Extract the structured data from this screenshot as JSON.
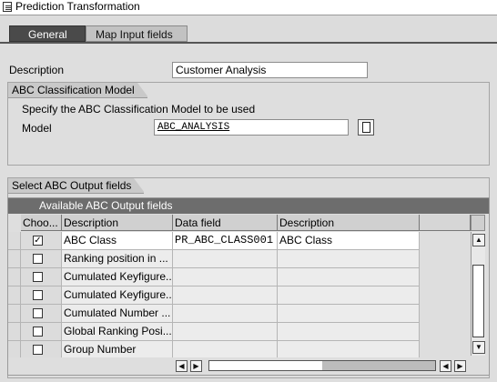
{
  "window": {
    "title": "Prediction Transformation"
  },
  "tabs": [
    {
      "label": "General",
      "active": true
    },
    {
      "label": "Map Input fields",
      "active": false
    }
  ],
  "description": {
    "label": "Description",
    "value": "Customer Analysis"
  },
  "abc_model_group": {
    "title": "ABC Classification Model",
    "instruction": "Specify the ABC Classification Model to be used",
    "model_label": "Model",
    "model_value": "ABC_ANALYSIS",
    "value_help_icon": "document-icon"
  },
  "output_group": {
    "title": "Select ABC Output fields",
    "table": {
      "title": "Available ABC Output fields",
      "columns": [
        "Choo...",
        "Description",
        "Data field",
        "Description"
      ],
      "rows": [
        {
          "checked": true,
          "description": "ABC Class",
          "data_field": "PR_ABC_CLASS001",
          "description2": "ABC Class"
        },
        {
          "checked": false,
          "description": "Ranking position in ...",
          "data_field": "",
          "description2": ""
        },
        {
          "checked": false,
          "description": "Cumulated Keyfigure...",
          "data_field": "",
          "description2": ""
        },
        {
          "checked": false,
          "description": "Cumulated Keyfigure...",
          "data_field": "",
          "description2": ""
        },
        {
          "checked": false,
          "description": "Cumulated Number ...",
          "data_field": "",
          "description2": ""
        },
        {
          "checked": false,
          "description": "Global Ranking Posi...",
          "data_field": "",
          "description2": ""
        },
        {
          "checked": false,
          "description": "Group Number",
          "data_field": "",
          "description2": ""
        }
      ],
      "check_mark": "✓"
    }
  },
  "colors": {
    "active_tab_bg": "#4a4a4a",
    "table_title_bg": "#6d6d6d",
    "group_title_bg": "#c9c9c9",
    "panel_bg": "#dedede"
  }
}
